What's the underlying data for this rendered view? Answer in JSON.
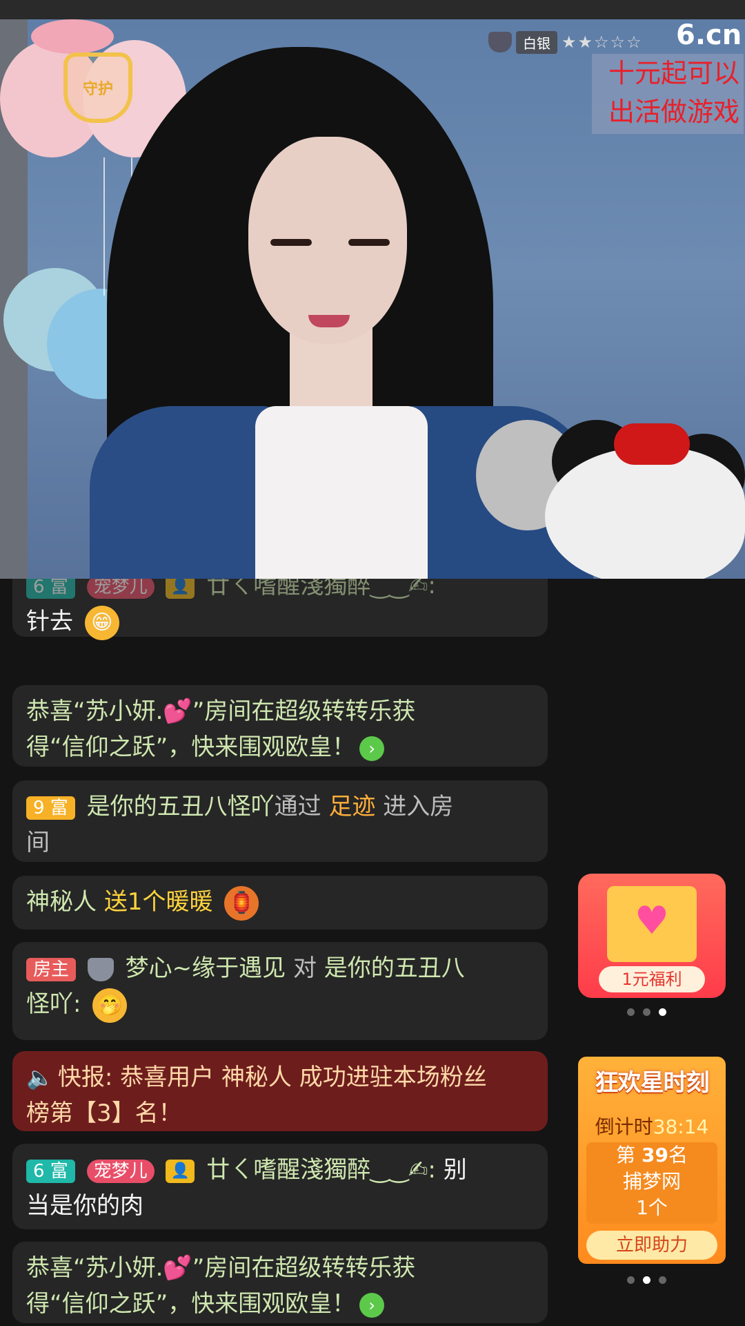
{
  "overlay": {
    "guard_badge": "守护",
    "rank_label": "白银",
    "rank_stars": "★★☆☆☆",
    "site_logo": "6.cn",
    "promo_line1": "十元起可以",
    "promo_line2": "出活做游戏"
  },
  "chat": {
    "messages": [
      {
        "rich_level": "6 富",
        "pet": "宠梦儿",
        "user": "廿ㄑ嗜醒淺獨醉‿‿✍:",
        "text_cont": "针去"
      },
      {
        "line1": "恭喜“苏小妍.💕”房间在超级转转乐获",
        "line2": "得“信仰之跃”，快来围观欧皇！"
      },
      {
        "rich_level": "9 富",
        "user": "是你的五丑八怪吖",
        "via": "通过",
        "item": "足迹",
        "action": "进入房",
        "action2": "间"
      },
      {
        "user": "神秘人",
        "gift": "送1个暖暖"
      },
      {
        "role": "房主",
        "user": "梦心~缘于遇见",
        "to": "对",
        "target": "是你的五丑八",
        "target2": "怪吖:"
      },
      {
        "icon": "speaker-icon",
        "line1": "快报: 恭喜用户 神秘人 成功进驻本场粉丝",
        "line2": "榜第【3】名！"
      },
      {
        "rich_level": "6 富",
        "pet": "宠梦儿",
        "user": "廿ㄑ嗜醒淺獨醉‿‿✍:",
        "text": "别",
        "text2": "当是你的肉"
      },
      {
        "line1": "恭喜“苏小妍.💕”房间在超级转转乐获",
        "line2": "得“信仰之跃”，快来围观欧皇！"
      }
    ]
  },
  "side": {
    "welfare_label": "1元福利",
    "event_title": "狂欢星时刻",
    "countdown_label": "倒计时",
    "countdown_time": "38:14",
    "rank_prefix": "第",
    "rank_num": "39",
    "rank_suffix": "名",
    "prize_name": "捕梦网",
    "prize_count": "1个",
    "help_button": "立即助力"
  },
  "colors": {
    "accent_green": "#5cc94a",
    "alert_bg": "#6e1d1d",
    "card_red": "#ff3c4a",
    "card_orange": "#ff8a1e"
  }
}
